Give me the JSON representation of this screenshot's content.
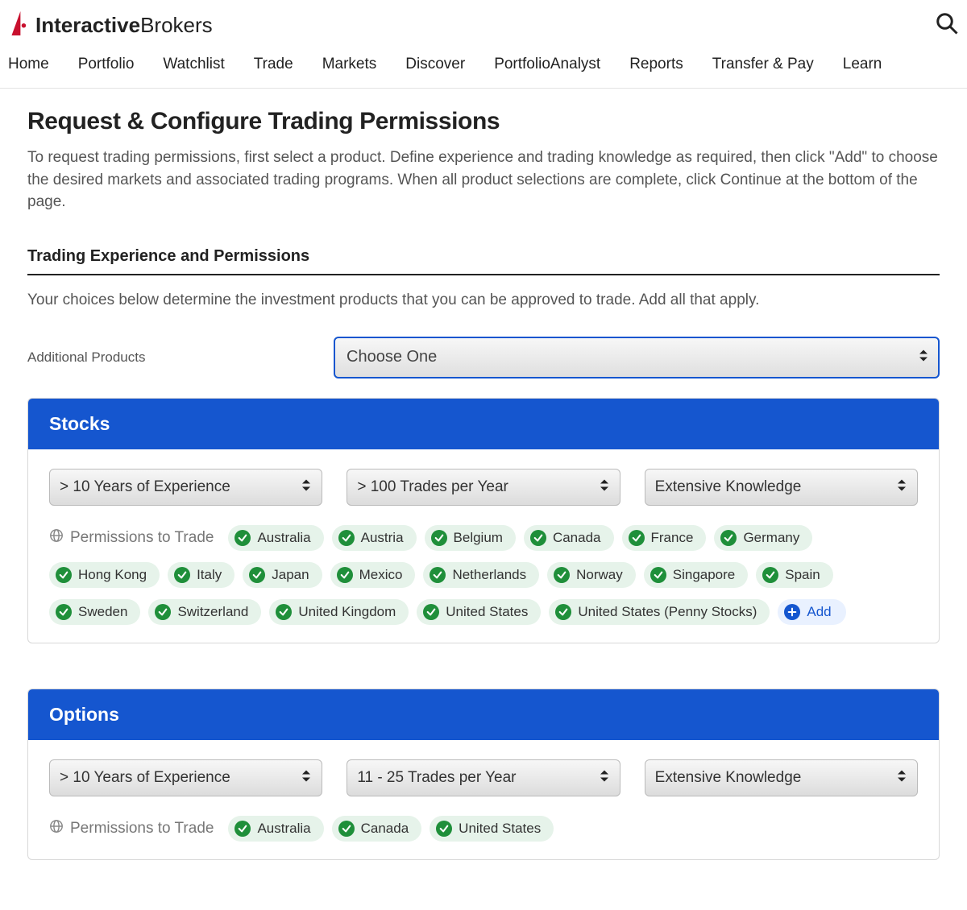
{
  "header": {
    "brand_bold": "Interactive",
    "brand_regular": "Brokers"
  },
  "nav": {
    "items": [
      "Home",
      "Portfolio",
      "Watchlist",
      "Trade",
      "Markets",
      "Discover",
      "PortfolioAnalyst",
      "Reports",
      "Transfer & Pay",
      "Learn"
    ]
  },
  "page": {
    "title": "Request & Configure Trading Permissions",
    "intro": "To request trading permissions, first select a product. Define experience and trading knowledge as required, then click \"Add\" to choose the desired markets and associated trading programs. When all product selections are complete, click Continue at the bottom of the page.",
    "section_title": "Trading Experience and Permissions",
    "section_desc": "Your choices below determine the investment products that you can be approved to trade. Add all that apply.",
    "additional_label": "Additional Products",
    "additional_select_value": "Choose One",
    "permissions_label": "Permissions to Trade",
    "add_label": "Add"
  },
  "panel_stocks": {
    "title": "Stocks",
    "experience": "> 10 Years of Experience",
    "trades": "> 100 Trades per Year",
    "knowledge": "Extensive Knowledge",
    "markets": [
      "Australia",
      "Austria",
      "Belgium",
      "Canada",
      "France",
      "Germany",
      "Hong Kong",
      "Italy",
      "Japan",
      "Mexico",
      "Netherlands",
      "Norway",
      "Singapore",
      "Spain",
      "Sweden",
      "Switzerland",
      "United Kingdom",
      "United States",
      "United States (Penny Stocks)"
    ]
  },
  "panel_options": {
    "title": "Options",
    "experience": "> 10 Years of Experience",
    "trades": "11 - 25 Trades per Year",
    "knowledge": "Extensive Knowledge",
    "markets": [
      "Australia",
      "Canada",
      "United States"
    ]
  }
}
